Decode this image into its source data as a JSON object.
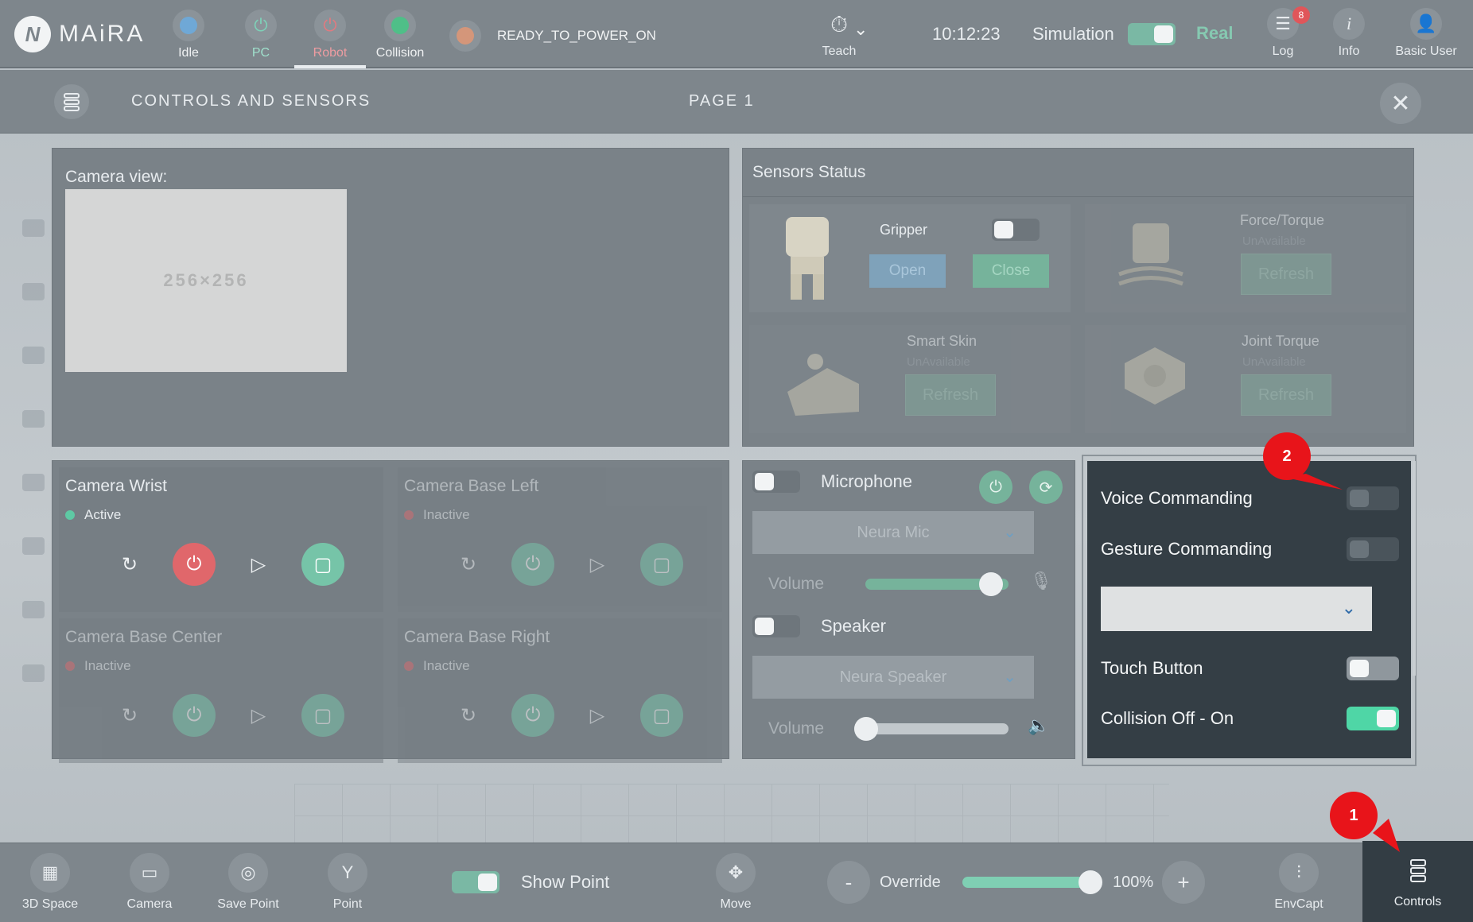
{
  "app": {
    "name": "MAiRA"
  },
  "topbar": {
    "statuses": [
      {
        "label": "Idle",
        "color": "#6fa8d6"
      },
      {
        "label": "PC",
        "color": "#7ed1b8"
      },
      {
        "label": "Robot",
        "color": "#e07a80"
      },
      {
        "label": "Collision",
        "color": "#4fbf88"
      }
    ],
    "state_text": "READY_TO_POWER_ON",
    "teach_label": "Teach",
    "clock": "10:12:23",
    "simulation_label": "Simulation",
    "real_label": "Real",
    "log_label": "Log",
    "log_badge": "8",
    "info_label": "Info",
    "user_label": "Basic User"
  },
  "panel": {
    "title": "CONTROLS AND SENSORS",
    "page": "PAGE 1",
    "camera_view_label": "Camera view:",
    "camera_placeholder": "256×256"
  },
  "sensors": {
    "title": "Sensors Status",
    "gripper": {
      "name": "Gripper",
      "open": "Open",
      "close": "Close"
    },
    "force_torque": {
      "name": "Force/Torque",
      "status": "UnAvailable",
      "refresh": "Refresh"
    },
    "smart_skin": {
      "name": "Smart Skin",
      "status": "UnAvailable",
      "refresh": "Refresh"
    },
    "joint_torque": {
      "name": "Joint Torque",
      "status": "UnAvailable",
      "refresh": "Refresh"
    }
  },
  "cameras": [
    {
      "name": "Camera Wrist",
      "status": "Active"
    },
    {
      "name": "Camera Base Left",
      "status": "Inactive"
    },
    {
      "name": "Camera Base Center",
      "status": "Inactive"
    },
    {
      "name": "Camera Base Right",
      "status": "Inactive"
    }
  ],
  "audio": {
    "microphone": "Microphone",
    "mic_device": "Neura Mic",
    "volume_label": "Volume",
    "mic_volume": 0.95,
    "speaker": "Speaker",
    "speaker_device": "Neura Speaker",
    "speaker_volume": 0.0
  },
  "commanding": {
    "voice": "Voice Commanding",
    "gesture": "Gesture Commanding",
    "touch": "Touch Button",
    "collision": "Collision Off - On"
  },
  "bottombar": {
    "space3d": "3D Space",
    "camera": "Camera",
    "save_point": "Save Point",
    "point": "Point",
    "show_point": "Show Point",
    "move": "Move",
    "minus": "-",
    "override": "Override",
    "override_value": "100%",
    "plus": "+",
    "envcapt": "EnvCapt",
    "controls": "Controls"
  },
  "markers": {
    "one": "1",
    "two": "2"
  }
}
